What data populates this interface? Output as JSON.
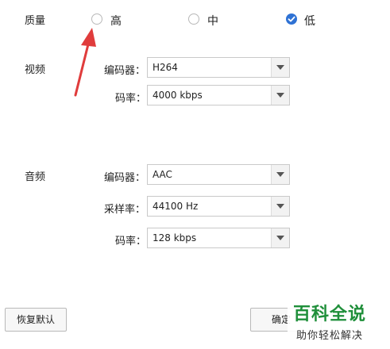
{
  "quality": {
    "label": "质量",
    "options": [
      "高",
      "中",
      "低"
    ],
    "selected": "低"
  },
  "video": {
    "section_label": "视频",
    "encoder_label": "编码器：",
    "encoder_value": "H264",
    "bitrate_label": "码率：",
    "bitrate_value": "4000 kbps"
  },
  "audio": {
    "section_label": "音频",
    "encoder_label": "编码器：",
    "encoder_value": "AAC",
    "samplerate_label": "采样率：",
    "samplerate_value": "44100 Hz",
    "bitrate_label": "码率：",
    "bitrate_value": "128 kbps"
  },
  "buttons": {
    "restore_default": "恢复默认",
    "confirm": "确定"
  },
  "watermark": {
    "title": "百科全说",
    "subtitle": "助你轻松解决"
  },
  "colors": {
    "accent": "#2f72d4",
    "annotation_arrow": "#e03c3c",
    "watermark": "#1f8f3a"
  }
}
